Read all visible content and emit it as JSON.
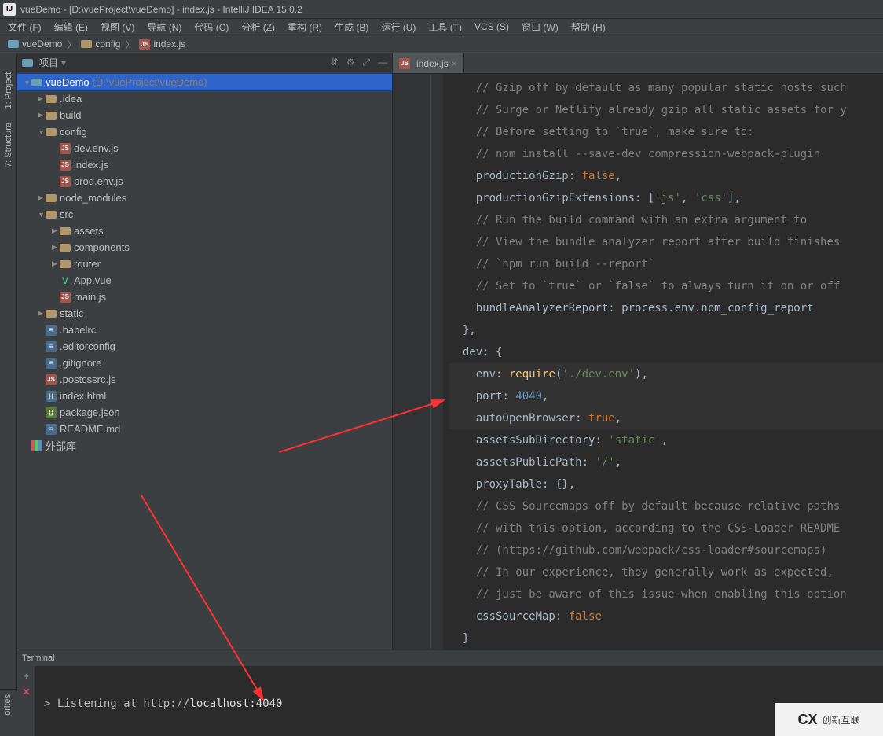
{
  "window_title": "vueDemo - [D:\\vueProject\\vueDemo] - index.js - IntelliJ IDEA 15.0.2",
  "menu": [
    "文件 (F)",
    "编辑 (E)",
    "视图 (V)",
    "导航 (N)",
    "代码 (C)",
    "分析 (Z)",
    "重构 (R)",
    "生成 (B)",
    "运行 (U)",
    "工具 (T)",
    "VCS (S)",
    "窗口 (W)",
    "帮助 (H)"
  ],
  "breadcrumbs": [
    "vueDemo",
    "config",
    "index.js"
  ],
  "sidebar_header": {
    "title": "项目"
  },
  "left_tabs": [
    "1: Project",
    "7: Structure"
  ],
  "bottom_left_tab": "orites",
  "tree": [
    {
      "depth": 0,
      "arrow": "▼",
      "icon": "folder-blue",
      "label": "vueDemo",
      "hint": "(D:\\vueProject\\vueDemo)",
      "selected": true
    },
    {
      "depth": 1,
      "arrow": "▶",
      "icon": "folder",
      "label": ".idea"
    },
    {
      "depth": 1,
      "arrow": "▶",
      "icon": "folder",
      "label": "build"
    },
    {
      "depth": 1,
      "arrow": "▼",
      "icon": "folder",
      "label": "config"
    },
    {
      "depth": 2,
      "arrow": "",
      "icon": "js",
      "label": "dev.env.js"
    },
    {
      "depth": 2,
      "arrow": "",
      "icon": "js",
      "label": "index.js"
    },
    {
      "depth": 2,
      "arrow": "",
      "icon": "js",
      "label": "prod.env.js"
    },
    {
      "depth": 1,
      "arrow": "▶",
      "icon": "folder",
      "label": "node_modules"
    },
    {
      "depth": 1,
      "arrow": "▼",
      "icon": "folder",
      "label": "src"
    },
    {
      "depth": 2,
      "arrow": "▶",
      "icon": "folder",
      "label": "assets"
    },
    {
      "depth": 2,
      "arrow": "▶",
      "icon": "folder",
      "label": "components"
    },
    {
      "depth": 2,
      "arrow": "▶",
      "icon": "folder",
      "label": "router"
    },
    {
      "depth": 2,
      "arrow": "",
      "icon": "vue",
      "label": "App.vue"
    },
    {
      "depth": 2,
      "arrow": "",
      "icon": "js",
      "label": "main.js"
    },
    {
      "depth": 1,
      "arrow": "▶",
      "icon": "folder",
      "label": "static"
    },
    {
      "depth": 1,
      "arrow": "",
      "icon": "file",
      "label": ".babelrc"
    },
    {
      "depth": 1,
      "arrow": "",
      "icon": "file",
      "label": ".editorconfig"
    },
    {
      "depth": 1,
      "arrow": "",
      "icon": "file",
      "label": ".gitignore"
    },
    {
      "depth": 1,
      "arrow": "",
      "icon": "js",
      "label": ".postcssrc.js"
    },
    {
      "depth": 1,
      "arrow": "",
      "icon": "html",
      "label": "index.html"
    },
    {
      "depth": 1,
      "arrow": "",
      "icon": "json",
      "label": "package.json"
    },
    {
      "depth": 1,
      "arrow": "",
      "icon": "file",
      "label": "README.md"
    },
    {
      "depth": 0,
      "arrow": "",
      "icon": "lib",
      "label": "外部库"
    }
  ],
  "editor_tab": {
    "filename": "index.js"
  },
  "code_lines": [
    [
      {
        "t": "comment",
        "v": "// Gzip off by default as many popular static hosts such"
      }
    ],
    [
      {
        "t": "comment",
        "v": "// Surge or Netlify already gzip all static assets for y"
      }
    ],
    [
      {
        "t": "comment",
        "v": "// Before setting to `true`, make sure to:"
      }
    ],
    [
      {
        "t": "comment",
        "v": "// npm install --save-dev compression-webpack-plugin"
      }
    ],
    [
      {
        "t": "prop",
        "v": "productionGzip"
      },
      {
        "t": "punc",
        "v": ": "
      },
      {
        "t": "key",
        "v": "false"
      },
      {
        "t": "punc",
        "v": ","
      }
    ],
    [
      {
        "t": "prop",
        "v": "productionGzipExtensions"
      },
      {
        "t": "punc",
        "v": ": ["
      },
      {
        "t": "str",
        "v": "'js'"
      },
      {
        "t": "punc",
        "v": ", "
      },
      {
        "t": "str",
        "v": "'css'"
      },
      {
        "t": "punc",
        "v": "],"
      }
    ],
    [
      {
        "t": "comment",
        "v": "// Run the build command with an extra argument to"
      }
    ],
    [
      {
        "t": "comment",
        "v": "// View the bundle analyzer report after build finishes"
      }
    ],
    [
      {
        "t": "comment",
        "v": "// `npm run build --report`"
      }
    ],
    [
      {
        "t": "comment",
        "v": "// Set to `true` or `false` to always turn it on or off"
      }
    ],
    [
      {
        "t": "prop",
        "v": "bundleAnalyzerReport"
      },
      {
        "t": "punc",
        "v": ": process.env.npm_config_report"
      }
    ],
    [
      {
        "t": "punc",
        "v": "},"
      }
    ],
    [
      {
        "t": "prop",
        "v": "dev"
      },
      {
        "t": "punc",
        "v": ": {"
      }
    ],
    [
      {
        "t": "prop",
        "v": "env"
      },
      {
        "t": "punc",
        "v": ": "
      },
      {
        "t": "ident",
        "v": "require"
      },
      {
        "t": "punc",
        "v": "("
      },
      {
        "t": "str",
        "v": "'./dev.env'"
      },
      {
        "t": "punc",
        "v": "),"
      }
    ],
    [
      {
        "t": "prop",
        "v": "port"
      },
      {
        "t": "punc",
        "v": ": "
      },
      {
        "t": "num",
        "v": "4040"
      },
      {
        "t": "punc",
        "v": ","
      }
    ],
    [
      {
        "t": "prop",
        "v": "autoOpenBrowser"
      },
      {
        "t": "punc",
        "v": ": "
      },
      {
        "t": "key",
        "v": "true"
      },
      {
        "t": "punc",
        "v": ","
      }
    ],
    [
      {
        "t": "prop",
        "v": "assetsSubDirectory"
      },
      {
        "t": "punc",
        "v": ": "
      },
      {
        "t": "str",
        "v": "'static'"
      },
      {
        "t": "punc",
        "v": ","
      }
    ],
    [
      {
        "t": "prop",
        "v": "assetsPublicPath"
      },
      {
        "t": "punc",
        "v": ": "
      },
      {
        "t": "str",
        "v": "'/'"
      },
      {
        "t": "punc",
        "v": ","
      }
    ],
    [
      {
        "t": "prop",
        "v": "proxyTable"
      },
      {
        "t": "punc",
        "v": ": {},"
      }
    ],
    [
      {
        "t": "comment",
        "v": "// CSS Sourcemaps off by default because relative paths "
      }
    ],
    [
      {
        "t": "comment",
        "v": "// with this option, according to the CSS-Loader README"
      }
    ],
    [
      {
        "t": "comment",
        "v": "// (https://github.com/webpack/css-loader#sourcemaps)"
      }
    ],
    [
      {
        "t": "comment",
        "v": "// In our experience, they generally work as expected,"
      }
    ],
    [
      {
        "t": "comment",
        "v": "// just be aware of this issue when enabling this option"
      }
    ],
    [
      {
        "t": "prop",
        "v": "cssSourceMap"
      },
      {
        "t": "punc",
        "v": ": "
      },
      {
        "t": "key",
        "v": "false"
      }
    ],
    [
      {
        "t": "punc",
        "v": "}"
      }
    ]
  ],
  "code_indents": [
    2,
    2,
    2,
    2,
    2,
    2,
    2,
    2,
    2,
    2,
    2,
    1,
    1,
    2,
    2,
    2,
    2,
    2,
    2,
    2,
    2,
    2,
    2,
    2,
    2,
    1
  ],
  "hl_lines": [
    13,
    14,
    15
  ],
  "terminal": {
    "title": "Terminal",
    "output_prefix": "> Listening at http://",
    "output_host": "localhost:4040"
  },
  "corner": {
    "brand": "创新互联"
  }
}
